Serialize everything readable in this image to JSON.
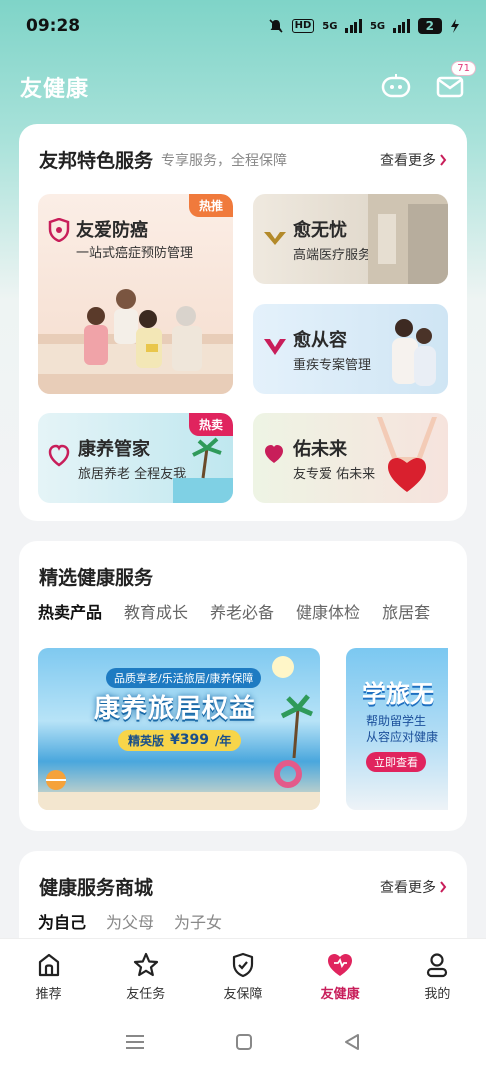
{
  "status": {
    "time": "09:28",
    "hd_label": "HD",
    "signal1": "5G",
    "signal2": "5G",
    "battery": "2"
  },
  "header": {
    "title": "友健康",
    "message_badge": "71",
    "icons": [
      "robot-chat-icon",
      "mail-icon"
    ]
  },
  "featured": {
    "title": "友邦特色服务",
    "subtitle": "专享服务，全程保障",
    "more": "查看更多",
    "tiles": [
      {
        "name": "友爱防癌",
        "desc": "一站式癌症预防管理",
        "tag": "热推",
        "tag_color": "#f07a3c"
      },
      {
        "name": "愈无忧",
        "desc": "高端医疗服务"
      },
      {
        "name": "愈从容",
        "desc": "重疾专案管理"
      },
      {
        "name": "康养管家",
        "desc": "旅居养老 全程友我",
        "tag": "热卖",
        "tag_color": "#e0245e"
      },
      {
        "name": "佑未来",
        "desc": "友专爱 佑未来"
      }
    ]
  },
  "selected": {
    "title": "精选健康服务",
    "tabs": [
      "热卖产品",
      "教育成长",
      "养老必备",
      "健康体检",
      "旅居套"
    ],
    "banner1": {
      "tagline": "品质享老/乐活旅居/康养保障",
      "headline": "康养旅居权益",
      "edition": "精英版",
      "price": "¥399",
      "price_unit": "/年"
    },
    "banner2": {
      "headline": "学旅无",
      "line1": "帮助留学生",
      "line2": "从容应对健康",
      "cta": "立即查看"
    }
  },
  "mall": {
    "title": "健康服务商城",
    "more": "查看更多",
    "tabs": [
      "为自己",
      "为父母",
      "为子女"
    ]
  },
  "nav": [
    {
      "label": "推荐",
      "icon": "home-icon"
    },
    {
      "label": "友任务",
      "icon": "star-icon"
    },
    {
      "label": "友保障",
      "icon": "shield-icon"
    },
    {
      "label": "友健康",
      "icon": "heart-icon",
      "active": true
    },
    {
      "label": "我的",
      "icon": "user-icon"
    }
  ],
  "colors": {
    "accent": "#c81e5a",
    "header_teal": "#7fd4c8"
  }
}
